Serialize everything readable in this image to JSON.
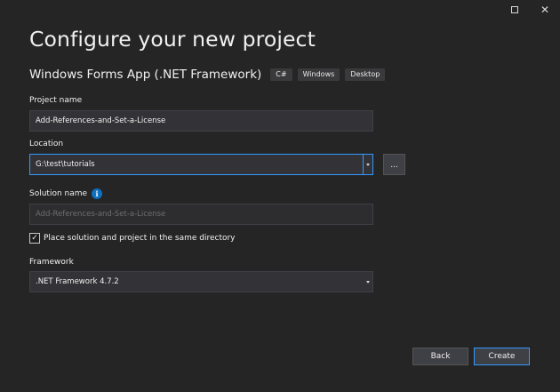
{
  "window": {
    "maximize_icon": "maximize-icon",
    "close_icon": "close-icon",
    "close_glyph": "✕"
  },
  "title": "Configure your new project",
  "template": {
    "name": "Windows Forms App (.NET Framework)",
    "tags": [
      "C#",
      "Windows",
      "Desktop"
    ]
  },
  "project_name": {
    "label": "Project name",
    "value": "Add-References-and-Set-a-License"
  },
  "location": {
    "label": "Location",
    "value": "G:\\test\\tutorials",
    "browse_label": "..."
  },
  "solution_name": {
    "label": "Solution name",
    "info_glyph": "i",
    "placeholder": "Add-References-and-Set-a-License"
  },
  "same_directory": {
    "checked": true,
    "check_glyph": "✓",
    "label": "Place solution and project in the same directory"
  },
  "framework": {
    "label": "Framework",
    "value": ".NET Framework 4.7.2"
  },
  "buttons": {
    "back": "Back",
    "create": "Create"
  },
  "colors": {
    "background": "#252526",
    "accent": "#3399ff",
    "info": "#0e70c0"
  }
}
